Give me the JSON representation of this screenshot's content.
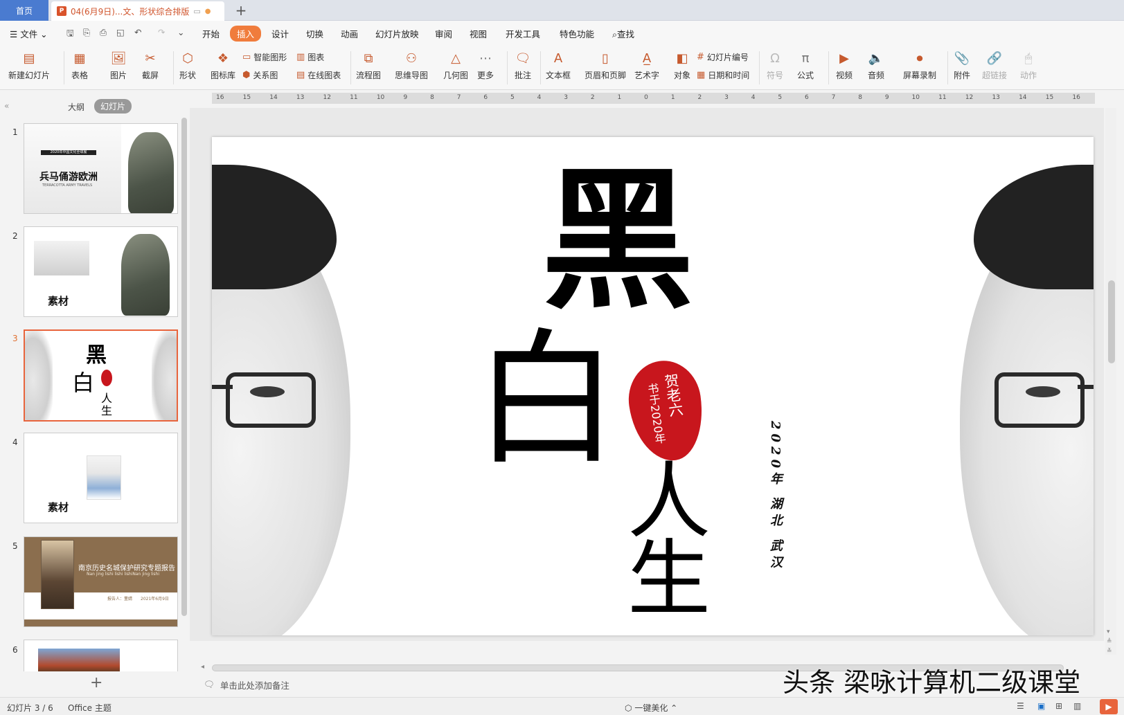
{
  "tabs": {
    "home": "首页",
    "doc": "04(6月9日)...文、形状综合排版",
    "add": "+"
  },
  "menu": {
    "file": "文件",
    "items": [
      "开始",
      "插入",
      "设计",
      "切换",
      "动画",
      "幻灯片放映",
      "审阅",
      "视图",
      "开发工具",
      "特色功能"
    ],
    "search": "查找"
  },
  "ribbon": {
    "new_slide": "新建幻灯片",
    "table": "表格",
    "picture": "图片",
    "screenshot": "截屏",
    "shape": "形状",
    "icon_lib": "图标库",
    "smart_art": "智能图形",
    "chart": "图表",
    "relation": "关系图",
    "online_chart": "在线图表",
    "flowchart": "流程图",
    "mindmap": "思维导图",
    "geometry": "几何图",
    "more": "更多",
    "comment": "批注",
    "textbox": "文本框",
    "header_footer": "页眉和页脚",
    "wordart": "艺术字",
    "object": "对象",
    "slide_number": "幻灯片编号",
    "date_time": "日期和时间",
    "symbol": "符号",
    "formula": "公式",
    "video": "视频",
    "audio": "音频",
    "screen_record": "屏幕录制",
    "attachment": "附件",
    "hyperlink": "超链接",
    "action": "动作"
  },
  "panel": {
    "outline": "大纲",
    "slides": "幻灯片",
    "add": "+"
  },
  "thumbs": [
    {
      "num": "1",
      "title": "兵马俑游欧洲",
      "small": "TERRACOTTA ARMY TRAVELS",
      "badge": "2020年中国文化全球展"
    },
    {
      "num": "2",
      "title": "素材"
    },
    {
      "num": "3",
      "big1": "黑",
      "big2": "白",
      "big3": "人",
      "big4": "生"
    },
    {
      "num": "4",
      "title": "素材"
    },
    {
      "num": "5",
      "title": "南京历史名城保护研究专题报告",
      "sub": "Nan jing lishi lishi lishiNan jing lishi",
      "reporter": "报告人：董婧",
      "date": "2021年6月9日"
    },
    {
      "num": "6"
    }
  ],
  "ruler": {
    "ticks": [
      "16",
      "15",
      "14",
      "13",
      "12",
      "11",
      "10",
      "9",
      "8",
      "7",
      "6",
      "5",
      "4",
      "3",
      "2",
      "1",
      "0",
      "1",
      "2",
      "3",
      "4",
      "5",
      "6",
      "7",
      "8",
      "9",
      "10",
      "11",
      "12",
      "13",
      "14",
      "15",
      "16"
    ]
  },
  "slide": {
    "hei": "黑",
    "bai": "白",
    "ren": "人",
    "sheng": "生",
    "stamp_line1": "贺老六",
    "stamp_line2": "书于2020年",
    "side_text": "2020年 湖北 武汉",
    "stamp_color": "#c8161d"
  },
  "notes": {
    "placeholder": "单击此处添加备注"
  },
  "status": {
    "slide_count": "幻灯片 3 / 6",
    "theme": "Office 主题",
    "beautify": "一键美化"
  },
  "watermark": "头条 梁咏计算机二级课堂"
}
